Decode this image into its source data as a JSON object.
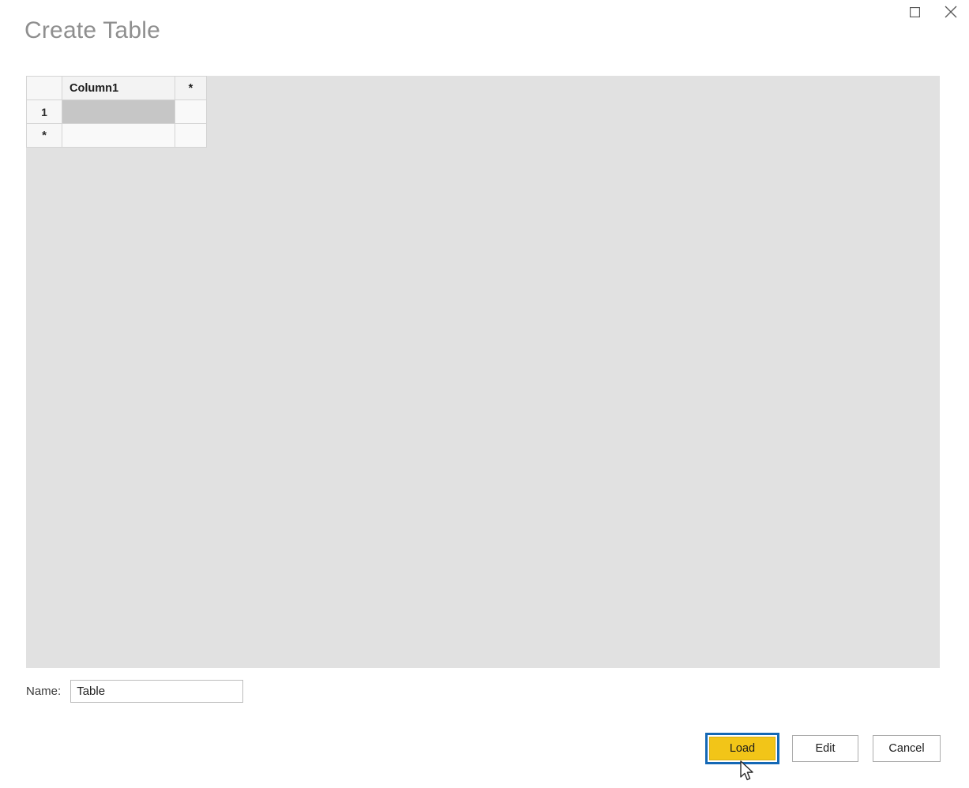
{
  "window": {
    "controls": [
      {
        "name": "maximize",
        "icon": "maximize-icon",
        "label": "Maximize"
      },
      {
        "name": "close",
        "icon": "close-icon",
        "label": "Close"
      }
    ]
  },
  "dialog": {
    "title": "Create Table"
  },
  "grid": {
    "columns": [
      "",
      "Column1",
      "*"
    ],
    "header_row": {
      "rowhdr": "",
      "column1": "Column1",
      "star": "*"
    },
    "rows": [
      {
        "row_header": "1",
        "column1": "",
        "star": "",
        "selected": true
      },
      {
        "row_header": "*",
        "column1": "",
        "star": "",
        "selected": false
      }
    ]
  },
  "name_field": {
    "label": "Name:",
    "value": "Table",
    "placeholder": ""
  },
  "footer": {
    "load_label": "Load",
    "edit_label": "Edit",
    "cancel_label": "Cancel"
  },
  "colors": {
    "accent_yellow": "#f2c518",
    "focus_blue": "#1468b5",
    "panel_gray": "#e1e1e1",
    "selected_cell": "#c6c6c6",
    "title_gray": "#8f8f8f"
  }
}
